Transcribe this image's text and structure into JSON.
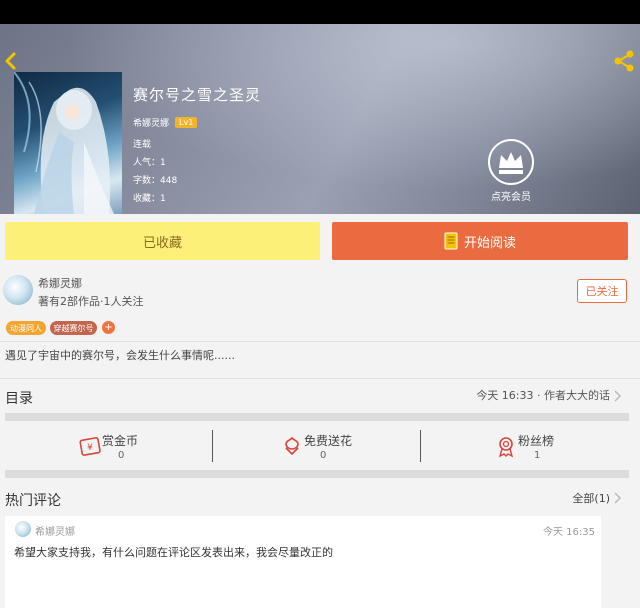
{
  "book": {
    "title": "赛尔号之雪之圣灵",
    "author": "希娜灵娜",
    "level": "Lv1",
    "status": "连载",
    "popularity": "人气：1",
    "word_count": "字数：448",
    "favorites": "收藏：1"
  },
  "vip": {
    "label": "点亮会员"
  },
  "actions": {
    "favorited_label": "已收藏",
    "start_reading_label": "开始阅读"
  },
  "author_info": {
    "name": "希娜灵娜",
    "works": "著有2部作品·1人关注",
    "follow_label": "已关注"
  },
  "tags": [
    "动漫同人",
    "穿越赛尔号",
    "+"
  ],
  "description": "遇见了宇宙中的赛尔号，会发生什么事情呢......",
  "toc": {
    "label": "目录",
    "update": "今天 16:33 · 作者大大的话"
  },
  "stats": [
    {
      "label": "赏金币",
      "value": "0",
      "icon": "gift-icon"
    },
    {
      "label": "免费送花",
      "value": "0",
      "icon": "flower-icon"
    },
    {
      "label": "粉丝榜",
      "value": "1",
      "icon": "medal-icon"
    }
  ],
  "hot_comments": {
    "title": "热门评论",
    "all_label": "全部(1)",
    "items": [
      {
        "user": "希娜灵娜",
        "time": "今天 16:35",
        "text": "希望大家支持我，有什么问题在评论区发表出来，我会尽量改正的"
      }
    ]
  },
  "colors": {
    "accent_orange": "#e96b3f",
    "favorite_yellow": "#fdf079",
    "level_badge": "#f3b32b"
  }
}
